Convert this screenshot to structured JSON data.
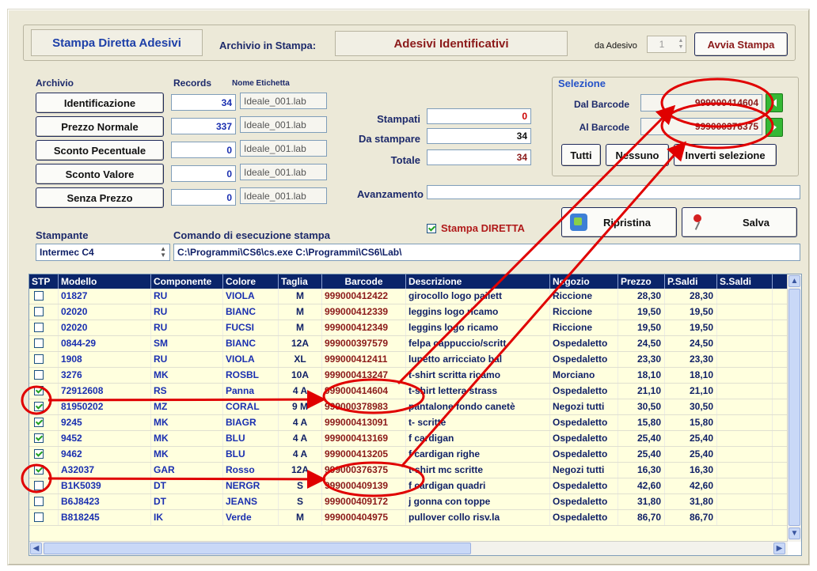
{
  "header": {
    "app_title": "Stampa Diretta Adesivi",
    "archivio_label": "Archivio in Stampa:",
    "archivio_value": "Adesivi Identificativi",
    "da_adesivo_label": "da Adesivo",
    "da_adesivo_value": "1",
    "avvia_label": "Avvia Stampa"
  },
  "archivio": {
    "col_archivio": "Archivio",
    "col_records": "Records",
    "col_nome": "Nome Etichetta",
    "rows": [
      {
        "label": "Identificazione",
        "records": "34",
        "file": "Ideale_001.lab"
      },
      {
        "label": "Prezzo Normale",
        "records": "337",
        "file": "Ideale_001.lab"
      },
      {
        "label": "Sconto Pecentuale",
        "records": "0",
        "file": "Ideale_001.lab"
      },
      {
        "label": "Sconto Valore",
        "records": "0",
        "file": "Ideale_001.lab"
      },
      {
        "label": "Senza Prezzo",
        "records": "0",
        "file": "Ideale_001.lab"
      }
    ]
  },
  "counts": {
    "stampati_label": "Stampati",
    "stampati_value": "0",
    "da_stampare_label": "Da stampare",
    "da_stampare_value": "34",
    "totale_label": "Totale",
    "totale_value": "34",
    "avanzamento_label": "Avanzamento",
    "avanzamento_progress": 0
  },
  "selezione": {
    "title": "Selezione",
    "dal_label": "Dal Barcode",
    "dal_value": "999000414604",
    "al_label": "Al Barcode",
    "al_value": "999000376375",
    "tutti": "Tutti",
    "nessuno": "Nessuno",
    "inverti": "Inverti selezione"
  },
  "actions": {
    "stampa_diretta": "Stampa DIRETTA",
    "ripristina": "Ripristina",
    "salva": "Salva"
  },
  "printer": {
    "stampante_label": "Stampante",
    "stampante_value": "Intermec C4",
    "comando_label": "Comando di esecuzione stampa",
    "comando_value": "C:\\Programmi\\CS6\\cs.exe C:\\Programmi\\CS6\\Lab\\"
  },
  "grid": {
    "headers": [
      "STP",
      "Modello",
      "Componente",
      "Colore",
      "Taglia",
      "Barcode",
      "Descrizione",
      "Negozio",
      "Prezzo",
      "P.Saldi",
      "S.Saldi"
    ],
    "rows": [
      {
        "stp": false,
        "modello": "01827",
        "comp": "RU",
        "colore": "VIOLA",
        "taglia": "M",
        "barcode": "999000412422",
        "desc": "girocollo logo pailett",
        "negozio": "Riccione",
        "prezzo": "28,30",
        "psaldi": "28,30"
      },
      {
        "stp": false,
        "modello": "02020",
        "comp": "RU",
        "colore": "BIANC",
        "taglia": "M",
        "barcode": "999000412339",
        "desc": "leggins logo ricamo",
        "negozio": "Riccione",
        "prezzo": "19,50",
        "psaldi": "19,50"
      },
      {
        "stp": false,
        "modello": "02020",
        "comp": "RU",
        "colore": "FUCSI",
        "taglia": "M",
        "barcode": "999000412349",
        "desc": "leggins logo ricamo",
        "negozio": "Riccione",
        "prezzo": "19,50",
        "psaldi": "19,50"
      },
      {
        "stp": false,
        "modello": "0844-29",
        "comp": "SM",
        "colore": "BIANC",
        "taglia": "12A",
        "barcode": "999000397579",
        "desc": "felpa cappuccio/scritt",
        "negozio": "Ospedaletto",
        "prezzo": "24,50",
        "psaldi": "24,50"
      },
      {
        "stp": false,
        "modello": "1908",
        "comp": "RU",
        "colore": "VIOLA",
        "taglia": "XL",
        "barcode": "999000412411",
        "desc": "lupetto arricciato bal",
        "negozio": "Ospedaletto",
        "prezzo": "23,30",
        "psaldi": "23,30"
      },
      {
        "stp": false,
        "modello": "3276",
        "comp": "MK",
        "colore": "ROSBL",
        "taglia": "10A",
        "barcode": "999000413247",
        "desc": "t-shirt scritta ricamo",
        "negozio": "Morciano",
        "prezzo": "18,10",
        "psaldi": "18,10"
      },
      {
        "stp": true,
        "modello": "72912608",
        "comp": "RS",
        "colore": "Panna",
        "taglia": "4 A",
        "barcode": "999000414604",
        "desc": "t-shirt lettera strass",
        "negozio": "Ospedaletto",
        "prezzo": "21,10",
        "psaldi": "21,10"
      },
      {
        "stp": true,
        "modello": "81950202",
        "comp": "MZ",
        "colore": "CORAL",
        "taglia": "9 M",
        "barcode": "999000378983",
        "desc": "pantalone fondo canetè",
        "negozio": "Negozi tutti",
        "prezzo": "30,50",
        "psaldi": "30,50"
      },
      {
        "stp": true,
        "modello": "9245",
        "comp": "MK",
        "colore": "BIAGR",
        "taglia": "4 A",
        "barcode": "999000413091",
        "desc": "t- scritte",
        "negozio": "Ospedaletto",
        "prezzo": "15,80",
        "psaldi": "15,80"
      },
      {
        "stp": true,
        "modello": "9452",
        "comp": "MK",
        "colore": "BLU",
        "taglia": "4 A",
        "barcode": "999000413169",
        "desc": "f cardigan",
        "negozio": "Ospedaletto",
        "prezzo": "25,40",
        "psaldi": "25,40"
      },
      {
        "stp": true,
        "modello": "9462",
        "comp": "MK",
        "colore": "BLU",
        "taglia": "4 A",
        "barcode": "999000413205",
        "desc": "f cardigan righe",
        "negozio": "Ospedaletto",
        "prezzo": "25,40",
        "psaldi": "25,40"
      },
      {
        "stp": true,
        "modello": "A32037",
        "comp": "GAR",
        "colore": "Rosso",
        "taglia": "12A",
        "barcode": "999000376375",
        "desc": "t-shirt mc scritte",
        "negozio": "Negozi tutti",
        "prezzo": "16,30",
        "psaldi": "16,30"
      },
      {
        "stp": false,
        "modello": "B1K5039",
        "comp": "DT",
        "colore": "NERGR",
        "taglia": "S",
        "barcode": "999000409139",
        "desc": "f cardigan quadri",
        "negozio": "Ospedaletto",
        "prezzo": "42,60",
        "psaldi": "42,60"
      },
      {
        "stp": false,
        "modello": "B6J8423",
        "comp": "DT",
        "colore": "JEANS",
        "taglia": "S",
        "barcode": "999000409172",
        "desc": "j gonna con toppe",
        "negozio": "Ospedaletto",
        "prezzo": "31,80",
        "psaldi": "31,80"
      },
      {
        "stp": false,
        "modello": "B818245",
        "comp": "IK",
        "colore": "Verde",
        "taglia": "M",
        "barcode": "999000404975",
        "desc": "pullover collo risv.la",
        "negozio": "Ospedaletto",
        "prezzo": "86,70",
        "psaldi": "86,70"
      }
    ]
  },
  "colors": {
    "accent_red": "#e00000",
    "header_navy": "#0a246a",
    "row_blue": "#1a2fb0",
    "barcode_red": "#8b1a1a"
  }
}
